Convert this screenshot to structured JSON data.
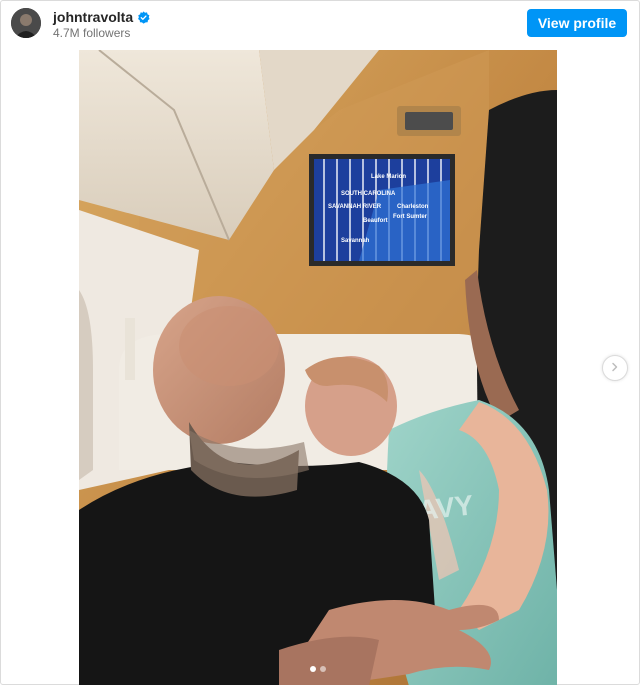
{
  "post": {
    "username": "johntravolta",
    "verified": true,
    "followers_text": "4.7M followers",
    "view_profile_label": "View profile"
  },
  "media": {
    "screen_map_labels": [
      "Lake Marion",
      "SOUTH CAROLINA",
      "Charleston",
      "SAVANNAH RIVER",
      "Beaufort",
      "Fort Sumter",
      "Savannah"
    ],
    "carousel": {
      "current": 1,
      "total": 2
    }
  },
  "icons": {
    "verified": "verified-badge-icon",
    "next": "chevron-right-icon"
  },
  "colors": {
    "accent": "#0095f6",
    "verified": "#0095f6",
    "text_primary": "#262626",
    "text_secondary": "#737373"
  }
}
